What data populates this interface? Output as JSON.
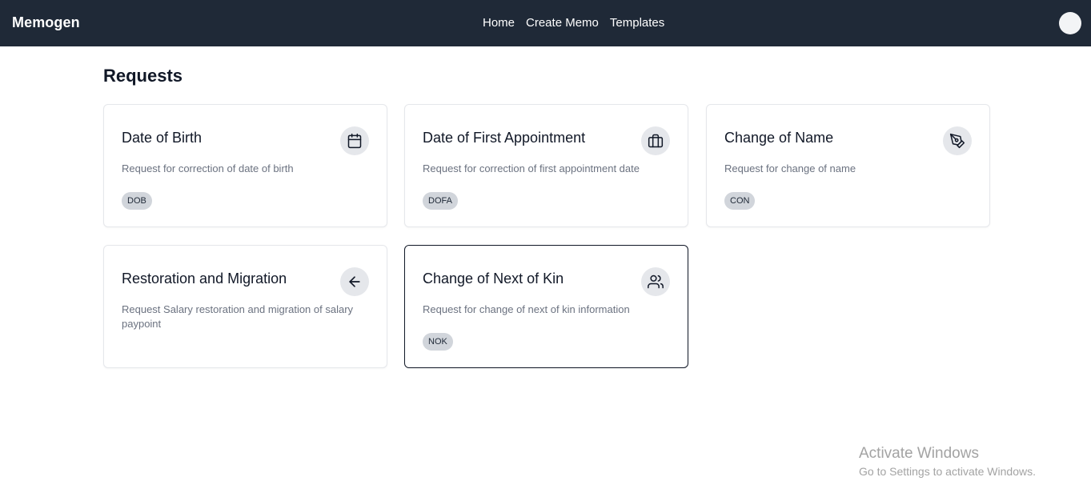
{
  "header": {
    "brand": "Memogen",
    "nav": [
      "Home",
      "Create Memo",
      "Templates"
    ]
  },
  "page": {
    "title": "Requests"
  },
  "cards": [
    {
      "title": "Date of Birth",
      "description": "Request for correction of date of birth",
      "badge": "DOB",
      "icon": "calendar-icon"
    },
    {
      "title": "Date of First Appointment",
      "description": "Request for correction of first appointment date",
      "badge": "DOFA",
      "icon": "briefcase-icon"
    },
    {
      "title": "Change of Name",
      "description": "Request for change of name",
      "badge": "CON",
      "icon": "pen-tool-icon"
    },
    {
      "title": "Restoration and Migration",
      "description": "Request Salary restoration and migration of salary paypoint",
      "badge": "",
      "icon": "arrow-left-icon"
    },
    {
      "title": "Change of Next of Kin",
      "description": "Request for change of next of kin information",
      "badge": "NOK",
      "icon": "users-icon",
      "selected": true
    }
  ],
  "watermark": {
    "title": "Activate Windows",
    "subtitle": "Go to Settings to activate Windows."
  }
}
